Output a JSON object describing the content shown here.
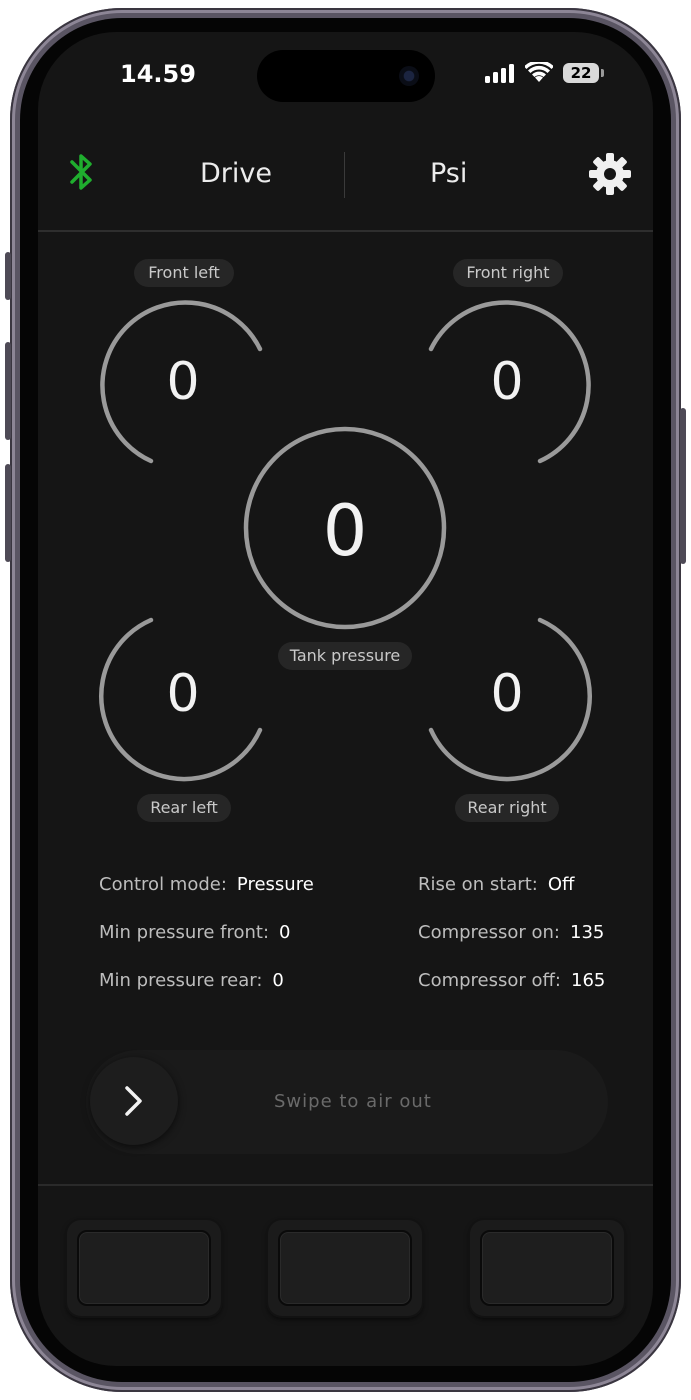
{
  "status_bar": {
    "time": "14.59",
    "battery": "22"
  },
  "header": {
    "mode": "Drive",
    "unit": "Psi"
  },
  "gauges": {
    "front_left": {
      "label": "Front left",
      "value": "0"
    },
    "front_right": {
      "label": "Front right",
      "value": "0"
    },
    "tank": {
      "label": "Tank pressure",
      "value": "0"
    },
    "rear_left": {
      "label": "Rear left",
      "value": "0"
    },
    "rear_right": {
      "label": "Rear right",
      "value": "0"
    }
  },
  "settings": {
    "control_mode": {
      "label": "Control mode:",
      "value": "Pressure"
    },
    "min_pressure_front": {
      "label": "Min pressure front:",
      "value": "0"
    },
    "min_pressure_rear": {
      "label": "Min pressure rear:",
      "value": "0"
    },
    "rise_on_start": {
      "label": "Rise on start:",
      "value": "Off"
    },
    "compressor_on": {
      "label": "Compressor on:",
      "value": "135"
    },
    "compressor_off": {
      "label": "Compressor off:",
      "value": "165"
    }
  },
  "swipe": {
    "text": "Swipe to air out"
  },
  "colors": {
    "bluetooth": "#1fae2e",
    "gauge_ring": "#9a9a9a",
    "background": "#151515"
  }
}
